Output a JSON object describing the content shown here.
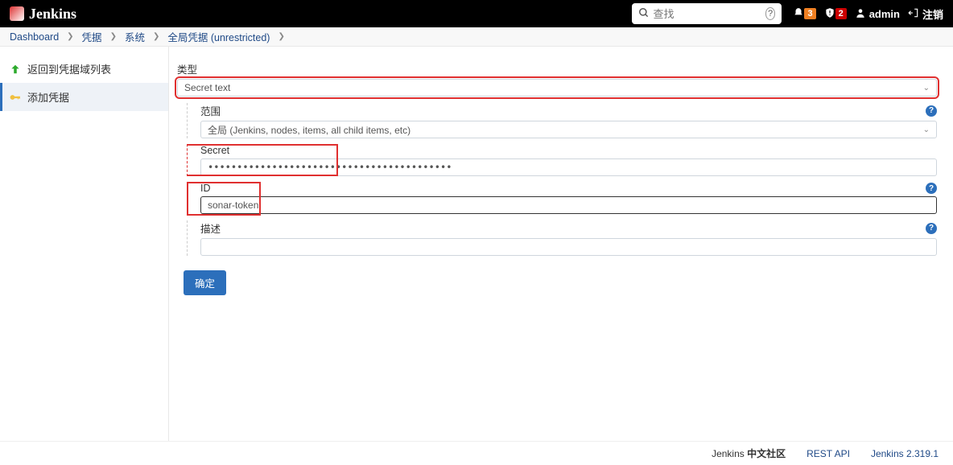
{
  "header": {
    "logo_text": "Jenkins",
    "search_placeholder": "查找",
    "notif_count": "3",
    "warn_count": "2",
    "user_label": "admin",
    "logout_label": "注销"
  },
  "breadcrumb": [
    "Dashboard",
    "凭据",
    "系统",
    "全局凭据 (unrestricted)"
  ],
  "sidebar": {
    "back_label": "返回到凭据域列表",
    "add_label": "添加凭据"
  },
  "form": {
    "type_label": "类型",
    "type_value": "Secret text",
    "scope_label": "范围",
    "scope_value": "全局 (Jenkins, nodes, items, all child items, etc)",
    "secret_label": "Secret",
    "secret_value": "••••••••••••••••••••••••••••••••••••••••••",
    "id_label": "ID",
    "id_value": "sonar-token",
    "desc_label": "描述",
    "desc_value": "",
    "submit_label": "确定"
  },
  "footer": {
    "community": "Jenkins 中文社区",
    "rest_api": "REST API",
    "version": "Jenkins 2.319.1"
  }
}
